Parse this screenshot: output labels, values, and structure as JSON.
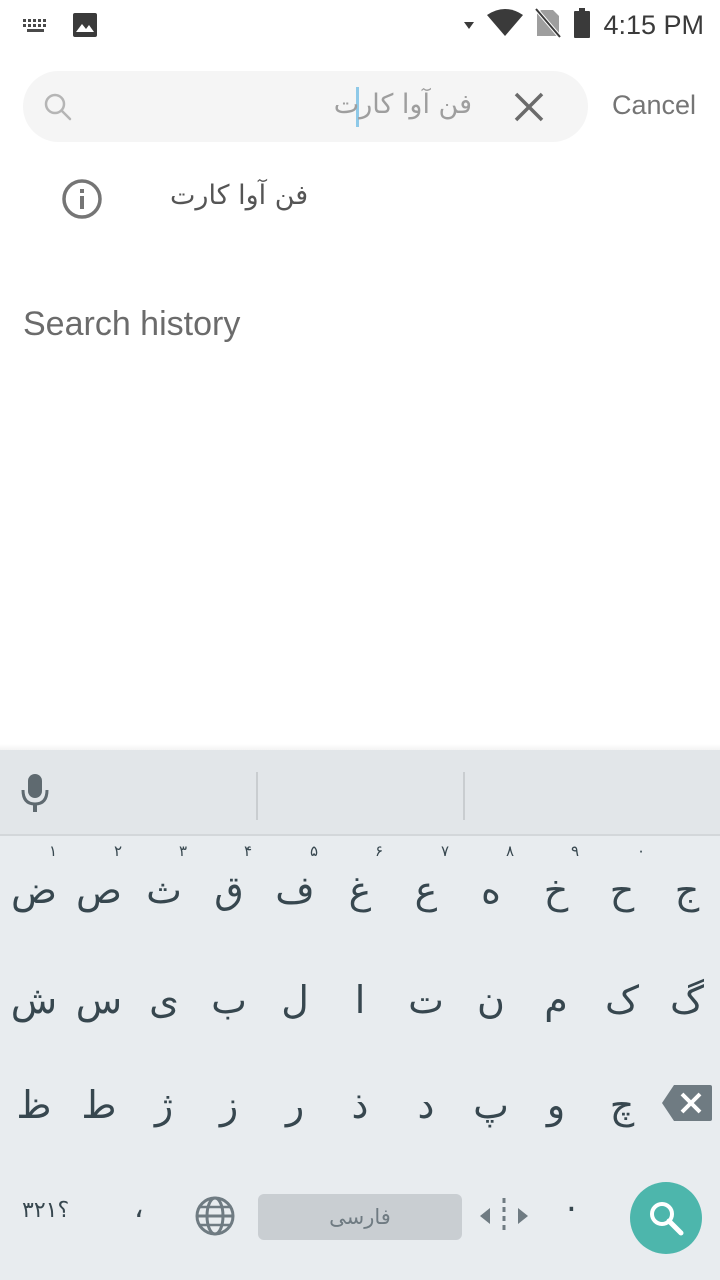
{
  "status_bar": {
    "time": "4:15 PM",
    "icons": [
      "keyboard-icon",
      "image-icon",
      "wifi-icon",
      "no-sim-icon",
      "battery-icon"
    ]
  },
  "search": {
    "query": "فن آوا کارت",
    "cancel_label": "Cancel"
  },
  "suggestions": [
    {
      "text": "فن آوا کارت",
      "icon": "info-icon"
    }
  ],
  "history": {
    "title": "Search history"
  },
  "keyboard": {
    "row1": [
      {
        "char": "ض",
        "hint": "۱"
      },
      {
        "char": "ص",
        "hint": "۲"
      },
      {
        "char": "ث",
        "hint": "۳"
      },
      {
        "char": "ق",
        "hint": "۴"
      },
      {
        "char": "ف",
        "hint": "۵"
      },
      {
        "char": "غ",
        "hint": "۶"
      },
      {
        "char": "ع",
        "hint": "۷"
      },
      {
        "char": "ه",
        "hint": "۸"
      },
      {
        "char": "خ",
        "hint": "۹"
      },
      {
        "char": "ح",
        "hint": "۰"
      },
      {
        "char": "ج",
        "hint": ""
      }
    ],
    "row2": [
      "ش",
      "س",
      "ی",
      "ب",
      "ل",
      "ا",
      "ت",
      "ن",
      "م",
      "ک",
      "گ"
    ],
    "row3": [
      "ظ",
      "ط",
      "ژ",
      "ز",
      "ر",
      "ذ",
      "د",
      "پ",
      "و",
      "چ"
    ],
    "symbols_label": "؟۳۲۱",
    "comma_label": "،",
    "space_label": "فارسی",
    "period_label": ".",
    "accent_color": "#4db6ac"
  }
}
